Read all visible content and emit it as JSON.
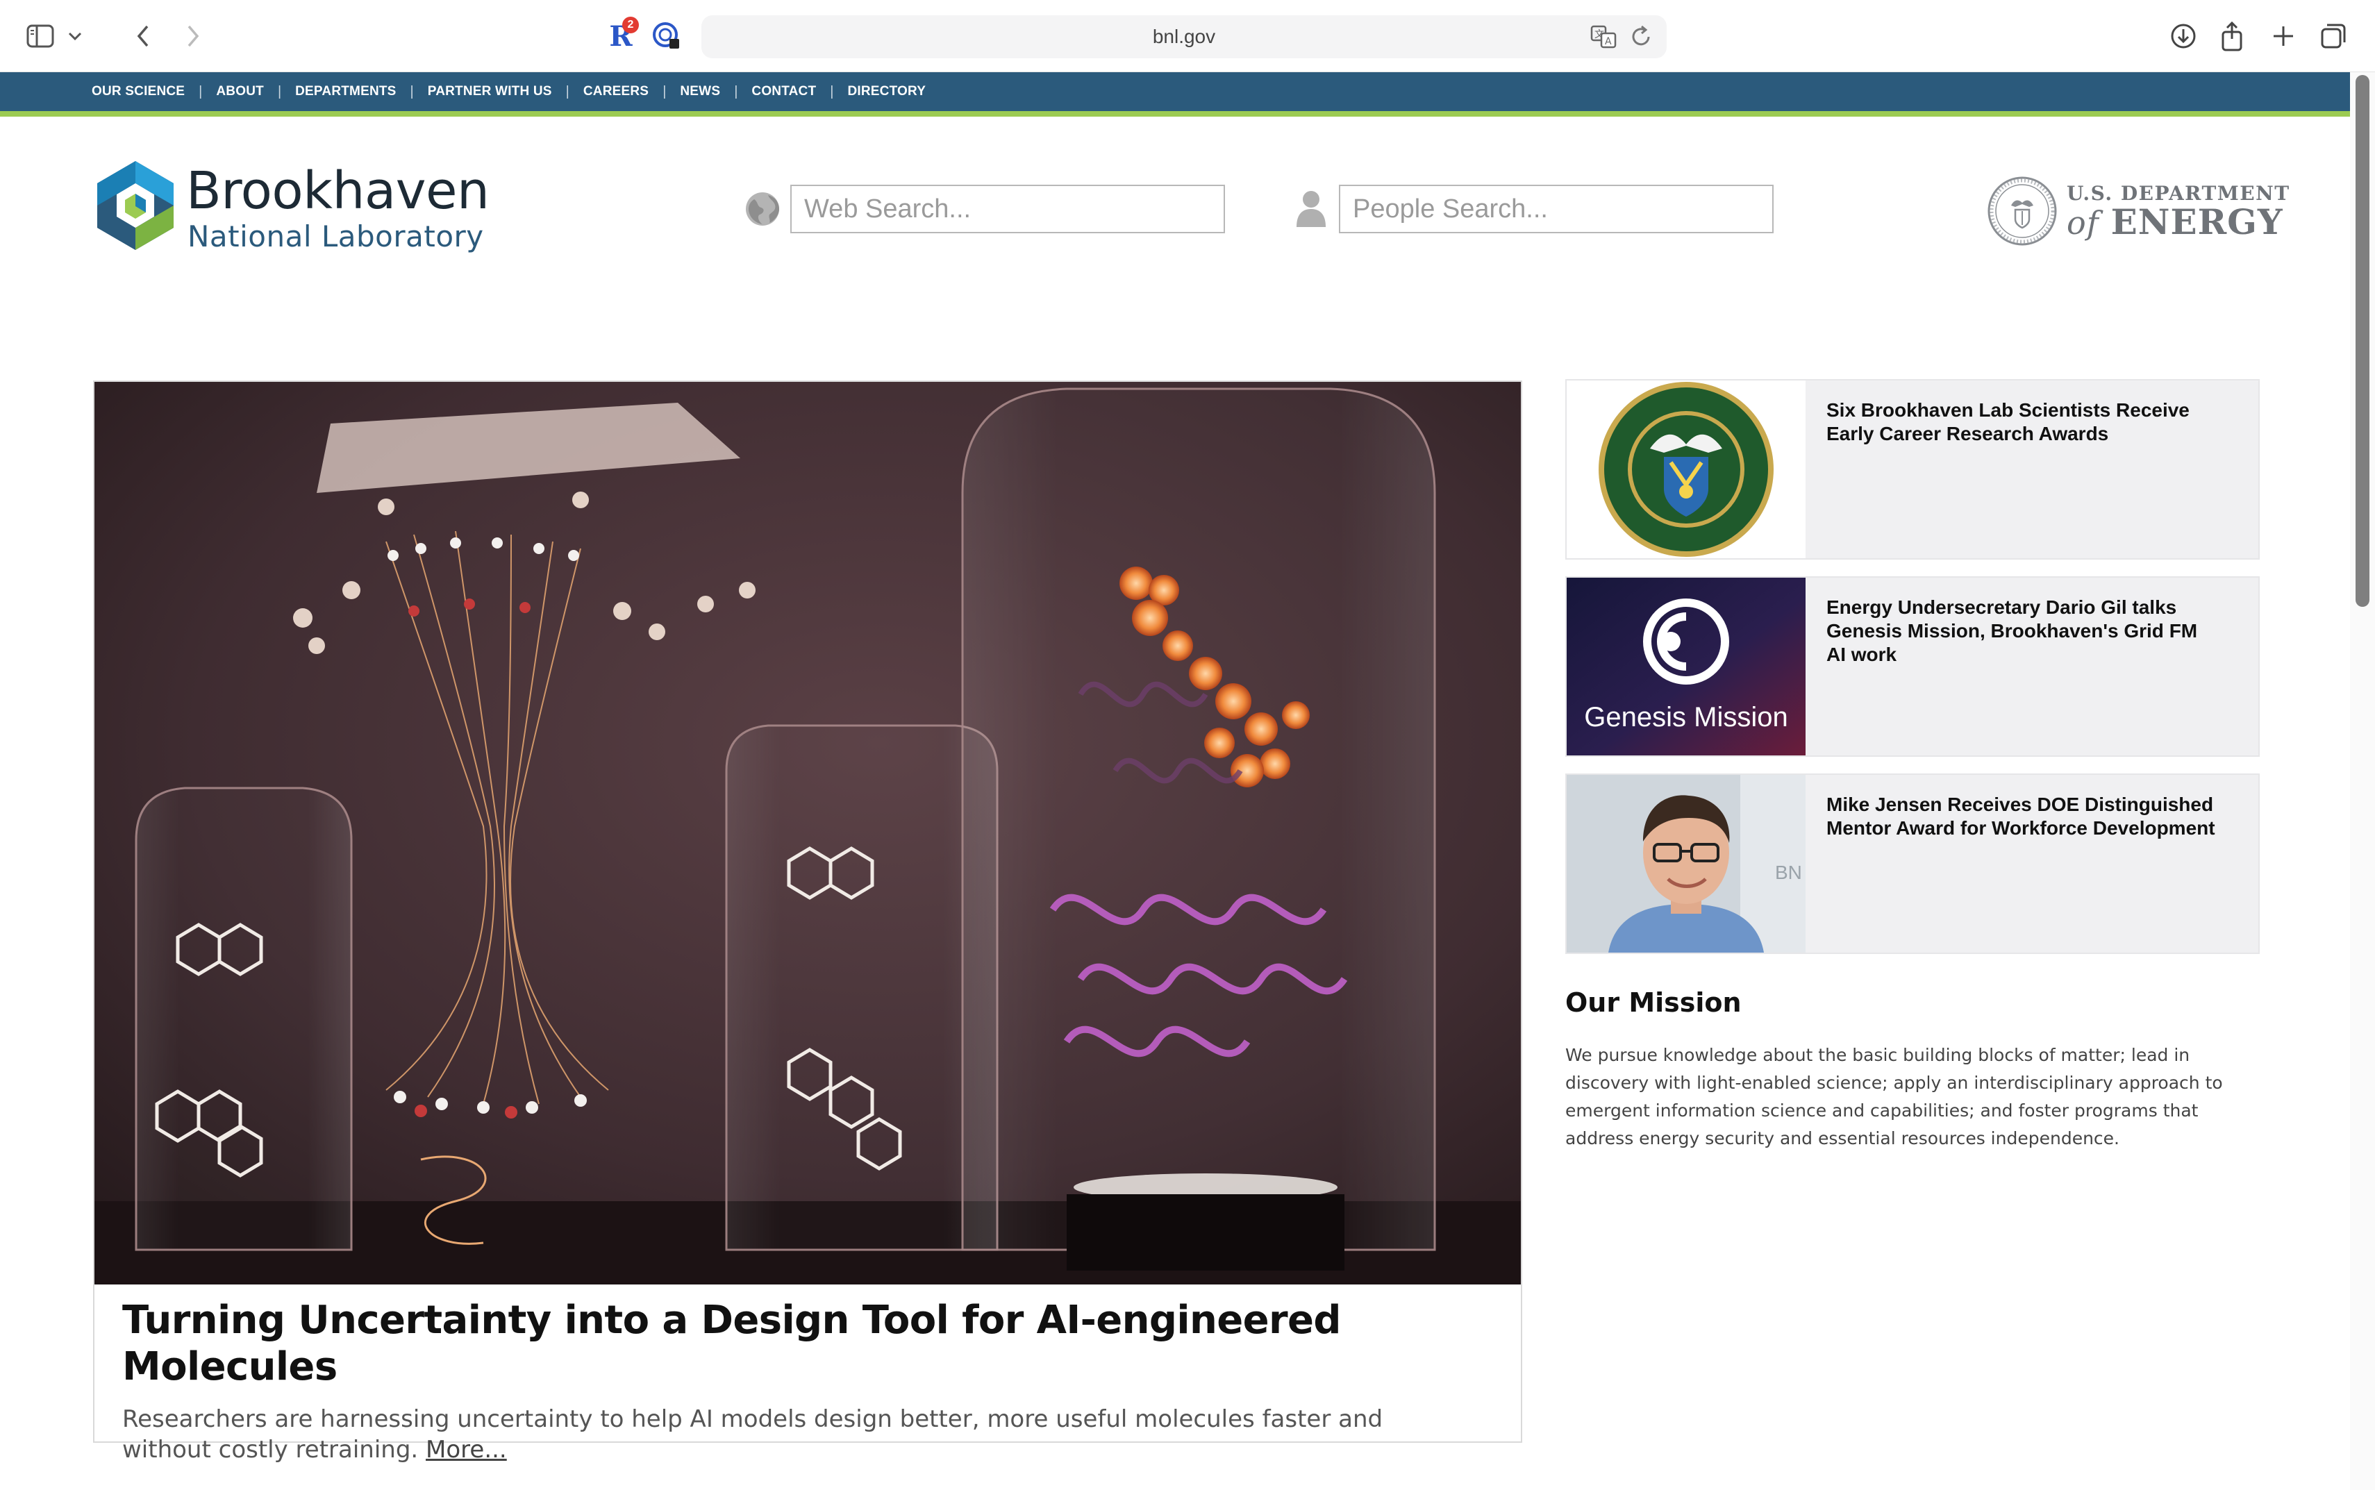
{
  "browser": {
    "url": "bnl.gov",
    "extension_badge": "2",
    "extension_letter": "R"
  },
  "topnav": {
    "items": [
      "OUR SCIENCE",
      "ABOUT",
      "DEPARTMENTS",
      "PARTNER WITH US",
      "CAREERS",
      "NEWS",
      "CONTACT",
      "DIRECTORY"
    ],
    "separator": "|",
    "bg_color": "#2b5a7c",
    "accent_color": "#9ccb52"
  },
  "header": {
    "logo_title": "Brookhaven",
    "logo_subtitle": "National Laboratory",
    "web_search_placeholder": "Web Search...",
    "people_search_placeholder": "People Search...",
    "doe_line1": "U.S. DEPARTMENT",
    "doe_of": "of",
    "doe_energy": "ENERGY"
  },
  "hero": {
    "title": "Turning Uncertainty into a Design Tool for AI-engineered Molecules",
    "description": "Researchers are harnessing uncertainty to help AI models design better, more useful molecules faster and without costly retraining.",
    "more_link": "More..."
  },
  "news": [
    {
      "title": "Six Brookhaven Lab Scientists Receive Early Career Research Awards",
      "thumb_icon": "doe-seal-icon"
    },
    {
      "title": "Energy Undersecretary Dario Gil talks Genesis Mission, Brookhaven's Grid FM AI work",
      "thumb_text": "Genesis Mission",
      "thumb_icon": "genesis-logo-icon"
    },
    {
      "title": "Mike Jensen Receives DOE Distinguished Mentor Award for Workforce Development",
      "thumb_icon": "portrait-photo"
    }
  ],
  "mission": {
    "title": "Our Mission",
    "body": "We pursue knowledge about the basic building blocks of matter; lead in discovery with light-enabled science; apply an interdisciplinary approach to emergent information science and capabilities; and foster programs that address energy security and essential resources independence."
  },
  "icons": {
    "sidebar": "sidebar-icon",
    "back": "chevron-left-icon",
    "forward": "chevron-right-icon",
    "download": "download-icon",
    "share": "share-icon",
    "new_tab": "plus-icon",
    "tabs": "tabs-icon",
    "translate": "translate-icon",
    "reload": "reload-icon",
    "globe": "globe-icon",
    "person": "person-icon"
  }
}
